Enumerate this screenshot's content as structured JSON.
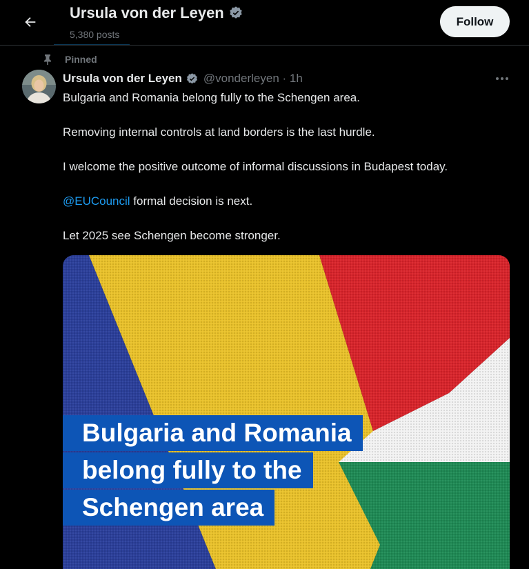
{
  "header": {
    "name": "Ursula von der Leyen",
    "post_count": "5,380 posts",
    "follow_label": "Follow"
  },
  "tweet": {
    "pinned_label": "Pinned",
    "author_name": "Ursula von der Leyen",
    "handle_time": "@vonderleyen · 1h",
    "line1": "Bulgaria and Romania belong fully to the Schengen area.",
    "line2": "Removing internal controls at land borders is the last hurdle.",
    "line3": "I welcome the positive outcome of informal discussions in Budapest today.",
    "line4_mention": "@EUCouncil",
    "line4_rest": " formal decision is next.",
    "line5": "Let 2025 see Schengen become stronger."
  },
  "media": {
    "caption": [
      "Bulgaria and Romania",
      "belong fully to the",
      "Schengen area"
    ]
  },
  "colors": {
    "accent": "#1d9bf0",
    "caption_bg": "#0d55b6",
    "romania_blue": "#2b3f9a",
    "romania_yellow": "#e9c12a",
    "romania_red": "#d8242b",
    "bulgaria_white": "#f2f2f2",
    "bulgaria_green": "#1f8a55"
  },
  "icons": {
    "back": "arrow-left-icon",
    "verified": "verified-badge-icon",
    "pin": "pin-icon",
    "more": "more-horizontal-icon"
  }
}
